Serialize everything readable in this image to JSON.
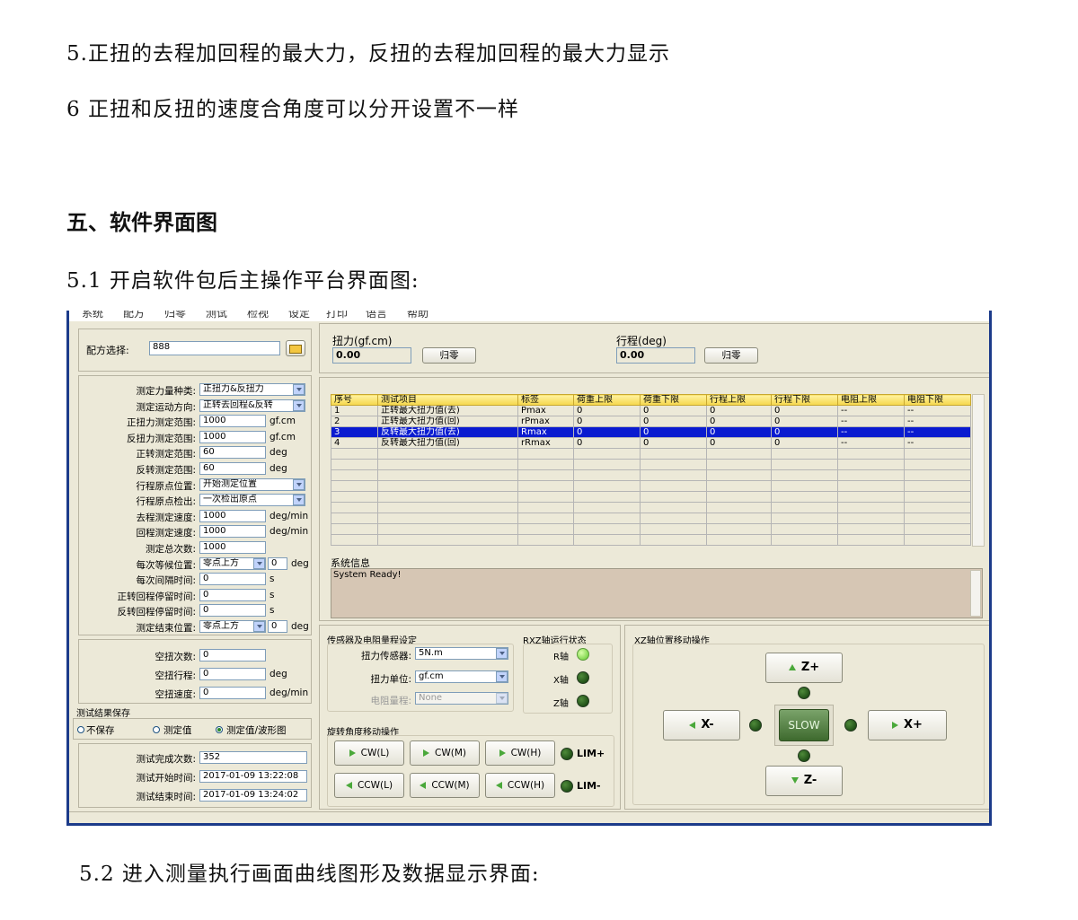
{
  "doc": {
    "line1": "5.正扭的去程加回程的最大力，反扭的去程加回程的最大力显示",
    "line2": "6 正扭和反扭的速度合角度可以分开设置不一样",
    "heading": "五、软件界面图",
    "line3": "5.1 开启软件包后主操作平台界面图:",
    "line4": "5.2 进入测量执行画面曲线图形及数据显示界面:"
  },
  "app": {
    "menu": [
      "系统",
      "配方",
      "归零",
      "测试",
      "检视",
      "设定",
      "打印",
      "语言",
      "帮助"
    ],
    "recipe": {
      "label": "配方选择:",
      "value": "888"
    },
    "params": [
      {
        "label": "测定力量种类:",
        "value": "正扭力&反扭力",
        "unit": ""
      },
      {
        "label": "测定运动方向:",
        "value": "正转去回程&反转",
        "unit": ""
      },
      {
        "label": "正扭力测定范围:",
        "value": "1000",
        "unit": "gf.cm"
      },
      {
        "label": "反扭力测定范围:",
        "value": "1000",
        "unit": "gf.cm"
      },
      {
        "label": "正转测定范围:",
        "value": "60",
        "unit": "deg"
      },
      {
        "label": "反转测定范围:",
        "value": "60",
        "unit": "deg"
      },
      {
        "label": "行程原点位置:",
        "value": "开始测定位置",
        "unit": ""
      },
      {
        "label": "行程原点检出:",
        "value": "一次检出原点",
        "unit": ""
      },
      {
        "label": "去程测定速度:",
        "value": "1000",
        "unit": "deg/min"
      },
      {
        "label": "回程测定速度:",
        "value": "1000",
        "unit": "deg/min"
      },
      {
        "label": "测定总次数:",
        "value": "1000",
        "unit": ""
      },
      {
        "label": "每次等候位置:",
        "value": "零点上方",
        "unit": "deg",
        "extra": "0"
      },
      {
        "label": "每次间隔时间:",
        "value": "0",
        "unit": "s"
      },
      {
        "label": "正转回程停留时间:",
        "value": "0",
        "unit": "s"
      },
      {
        "label": "反转回程停留时间:",
        "value": "0",
        "unit": "s"
      },
      {
        "label": "测定结束位置:",
        "value": "零点上方",
        "unit": "deg",
        "extra": "0"
      }
    ],
    "idle": [
      {
        "label": "空扭次数:",
        "value": "0",
        "unit": ""
      },
      {
        "label": "空扭行程:",
        "value": "0",
        "unit": "deg"
      },
      {
        "label": "空扭速度:",
        "value": "0",
        "unit": "deg/min"
      }
    ],
    "save": {
      "title": "测试结果保存",
      "options": [
        "不保存",
        "测定值",
        "测定值/波形图"
      ],
      "selected": 2
    },
    "stats": [
      {
        "label": "测试完成次数:",
        "value": "352"
      },
      {
        "label": "测试开始时间:",
        "value": "2017-01-09 13:22:08"
      },
      {
        "label": "测试结束时间:",
        "value": "2017-01-09 13:24:02"
      }
    ],
    "torque": {
      "label": "扭力(gf.cm)",
      "value": "0.00",
      "zero": "归零"
    },
    "stroke": {
      "label": "行程(deg)",
      "value": "0.00",
      "zero": "归零"
    },
    "table": {
      "headers": [
        "序号",
        "测试项目",
        "标签",
        "荷重上限",
        "荷重下限",
        "行程上限",
        "行程下限",
        "电阻上限",
        "电阻下限"
      ],
      "rows": [
        [
          "1",
          "正转最大扭力值(去)",
          "Pmax",
          "0",
          "0",
          "0",
          "0",
          "--",
          "--"
        ],
        [
          "2",
          "正转最大扭力值(回)",
          "rPmax",
          "0",
          "0",
          "0",
          "0",
          "--",
          "--"
        ],
        [
          "3",
          "反转最大扭力值(去)",
          "Rmax",
          "0",
          "0",
          "0",
          "0",
          "--",
          "--"
        ],
        [
          "4",
          "反转最大扭力值(回)",
          "rRmax",
          "0",
          "0",
          "0",
          "0",
          "--",
          "--"
        ]
      ],
      "selected_row": 2
    },
    "sysinfo": {
      "title": "系统信息",
      "text": "System Ready!"
    },
    "sensor": {
      "title": "传感器及电阻量程设定",
      "sensor_label": "扭力传感器:",
      "sensor_value": "5N.m",
      "unit_label": "扭力单位:",
      "unit_value": "gf.cm",
      "res_label": "电阻量程:",
      "res_value": "None"
    },
    "axis_status": {
      "title": "RXZ轴运行状态",
      "r": "R轴",
      "x": "X轴",
      "z": "Z轴"
    },
    "rotate": {
      "title": "旋转角度移动操作",
      "cw": [
        "CW(L)",
        "CW(M)",
        "CW(H)"
      ],
      "ccw": [
        "CCW(L)",
        "CCW(M)",
        "CCW(H)"
      ],
      "lim_plus": "LIM+",
      "lim_minus": "LIM-"
    },
    "xz": {
      "title": "XZ轴位置移动操作",
      "zplus": "Z+",
      "zminus": "Z-",
      "xminus": "X-",
      "xplus": "X+",
      "slow": "SLOW"
    }
  }
}
